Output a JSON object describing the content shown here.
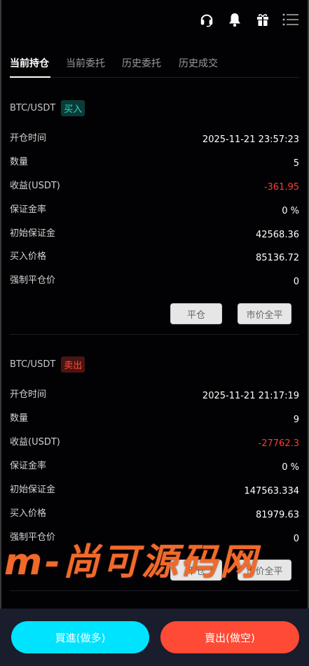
{
  "icons": {
    "support": "headset-icon",
    "notifications": "bell-icon",
    "gift": "gift-icon",
    "menu": "menu-icon"
  },
  "tabs": [
    {
      "label": "当前持仓",
      "active": true
    },
    {
      "label": "当前委托",
      "active": false
    },
    {
      "label": "历史委托",
      "active": false
    },
    {
      "label": "历史成交",
      "active": false
    }
  ],
  "positions": [
    {
      "pair": "BTC/USDT",
      "side": "买入",
      "rows": [
        {
          "label": "开仓时间",
          "value": "2025-11-21 23:57:23"
        },
        {
          "label": "数量",
          "value": "5"
        },
        {
          "label": "收益(USDT)",
          "value": "-361.95"
        },
        {
          "label": "保证金率",
          "value": "0 %"
        },
        {
          "label": "初始保证金",
          "value": "42568.36"
        },
        {
          "label": "买入价格",
          "value": "85136.72"
        },
        {
          "label": "强制平仓价",
          "value": "0"
        }
      ],
      "close_label": "平仓",
      "market_close_label": "市价全平"
    },
    {
      "pair": "BTC/USDT",
      "side": "卖出",
      "rows": [
        {
          "label": "开仓时间",
          "value": "2025-11-21 21:17:19"
        },
        {
          "label": "数量",
          "value": "9"
        },
        {
          "label": "收益(USDT)",
          "value": "-27762.3"
        },
        {
          "label": "保证金率",
          "value": "0 %"
        },
        {
          "label": "初始保证金",
          "value": "147563.334"
        },
        {
          "label": "买入价格",
          "value": "81979.63"
        },
        {
          "label": "强制平仓价",
          "value": "0"
        }
      ],
      "close_label": "平仓",
      "market_close_label": "市价全平"
    }
  ],
  "watermark": "m-尚可源码网",
  "actions": {
    "buy_label": "買進(做多)",
    "sell_label": "賣出(做空)"
  },
  "colors": {
    "buy": "#00e3ff",
    "sell": "#ff4a35",
    "negative": "#ff3b30",
    "buy_badge": "#16e0c7"
  }
}
